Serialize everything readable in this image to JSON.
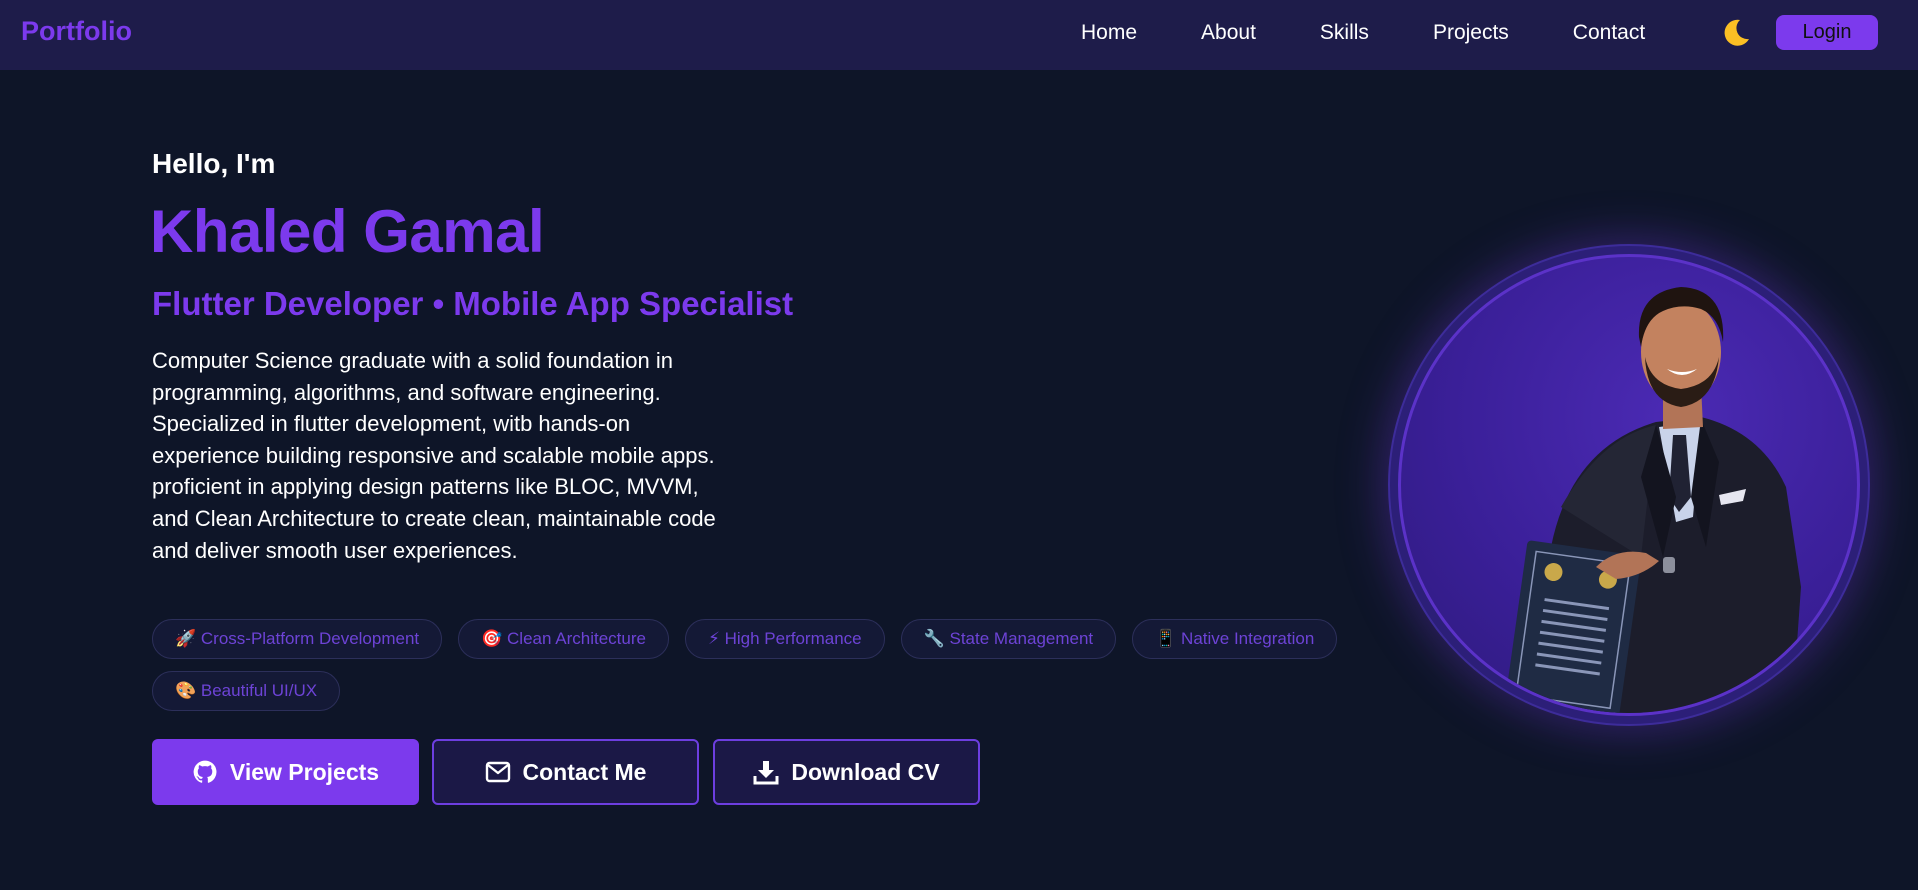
{
  "nav": {
    "brand": "Portfolio",
    "links": [
      "Home",
      "About",
      "Skills",
      "Projects",
      "Contact"
    ],
    "login_label": "Login"
  },
  "hero": {
    "greeting": "Hello, I'm",
    "name": "Khaled Gamal",
    "role": "Flutter Developer • Mobile App Specialist",
    "bio_1": "Computer Science graduate with a solid foundation in programming, algorithms, and software engineering. Specialized in flutter development, witb hands-on experience building responsive and scalable mobile apps.",
    "bio_2": "proficient in applying design patterns like BLOC, MVVM, and Clean Architecture to create clean, maintainable code and deliver smooth user experiences.",
    "tags": [
      "🚀 Cross-Platform Development",
      "🎯 Clean Architecture",
      "⚡ High Performance",
      "🔧 State Management",
      "📱 Native Integration",
      "🎨 Beautiful UI/UX"
    ],
    "buttons": {
      "view_projects": "View Projects",
      "contact_me": "Contact Me",
      "download_cv": "Download CV"
    }
  },
  "icons": {
    "theme": "moon-icon",
    "view_projects": "github-icon",
    "contact_me": "envelope-icon",
    "download_cv": "download-icon"
  },
  "colors": {
    "accent": "#7c3aed",
    "background": "#0e1528",
    "navbar": "#1e1c4a",
    "moon": "#fbbf24"
  }
}
